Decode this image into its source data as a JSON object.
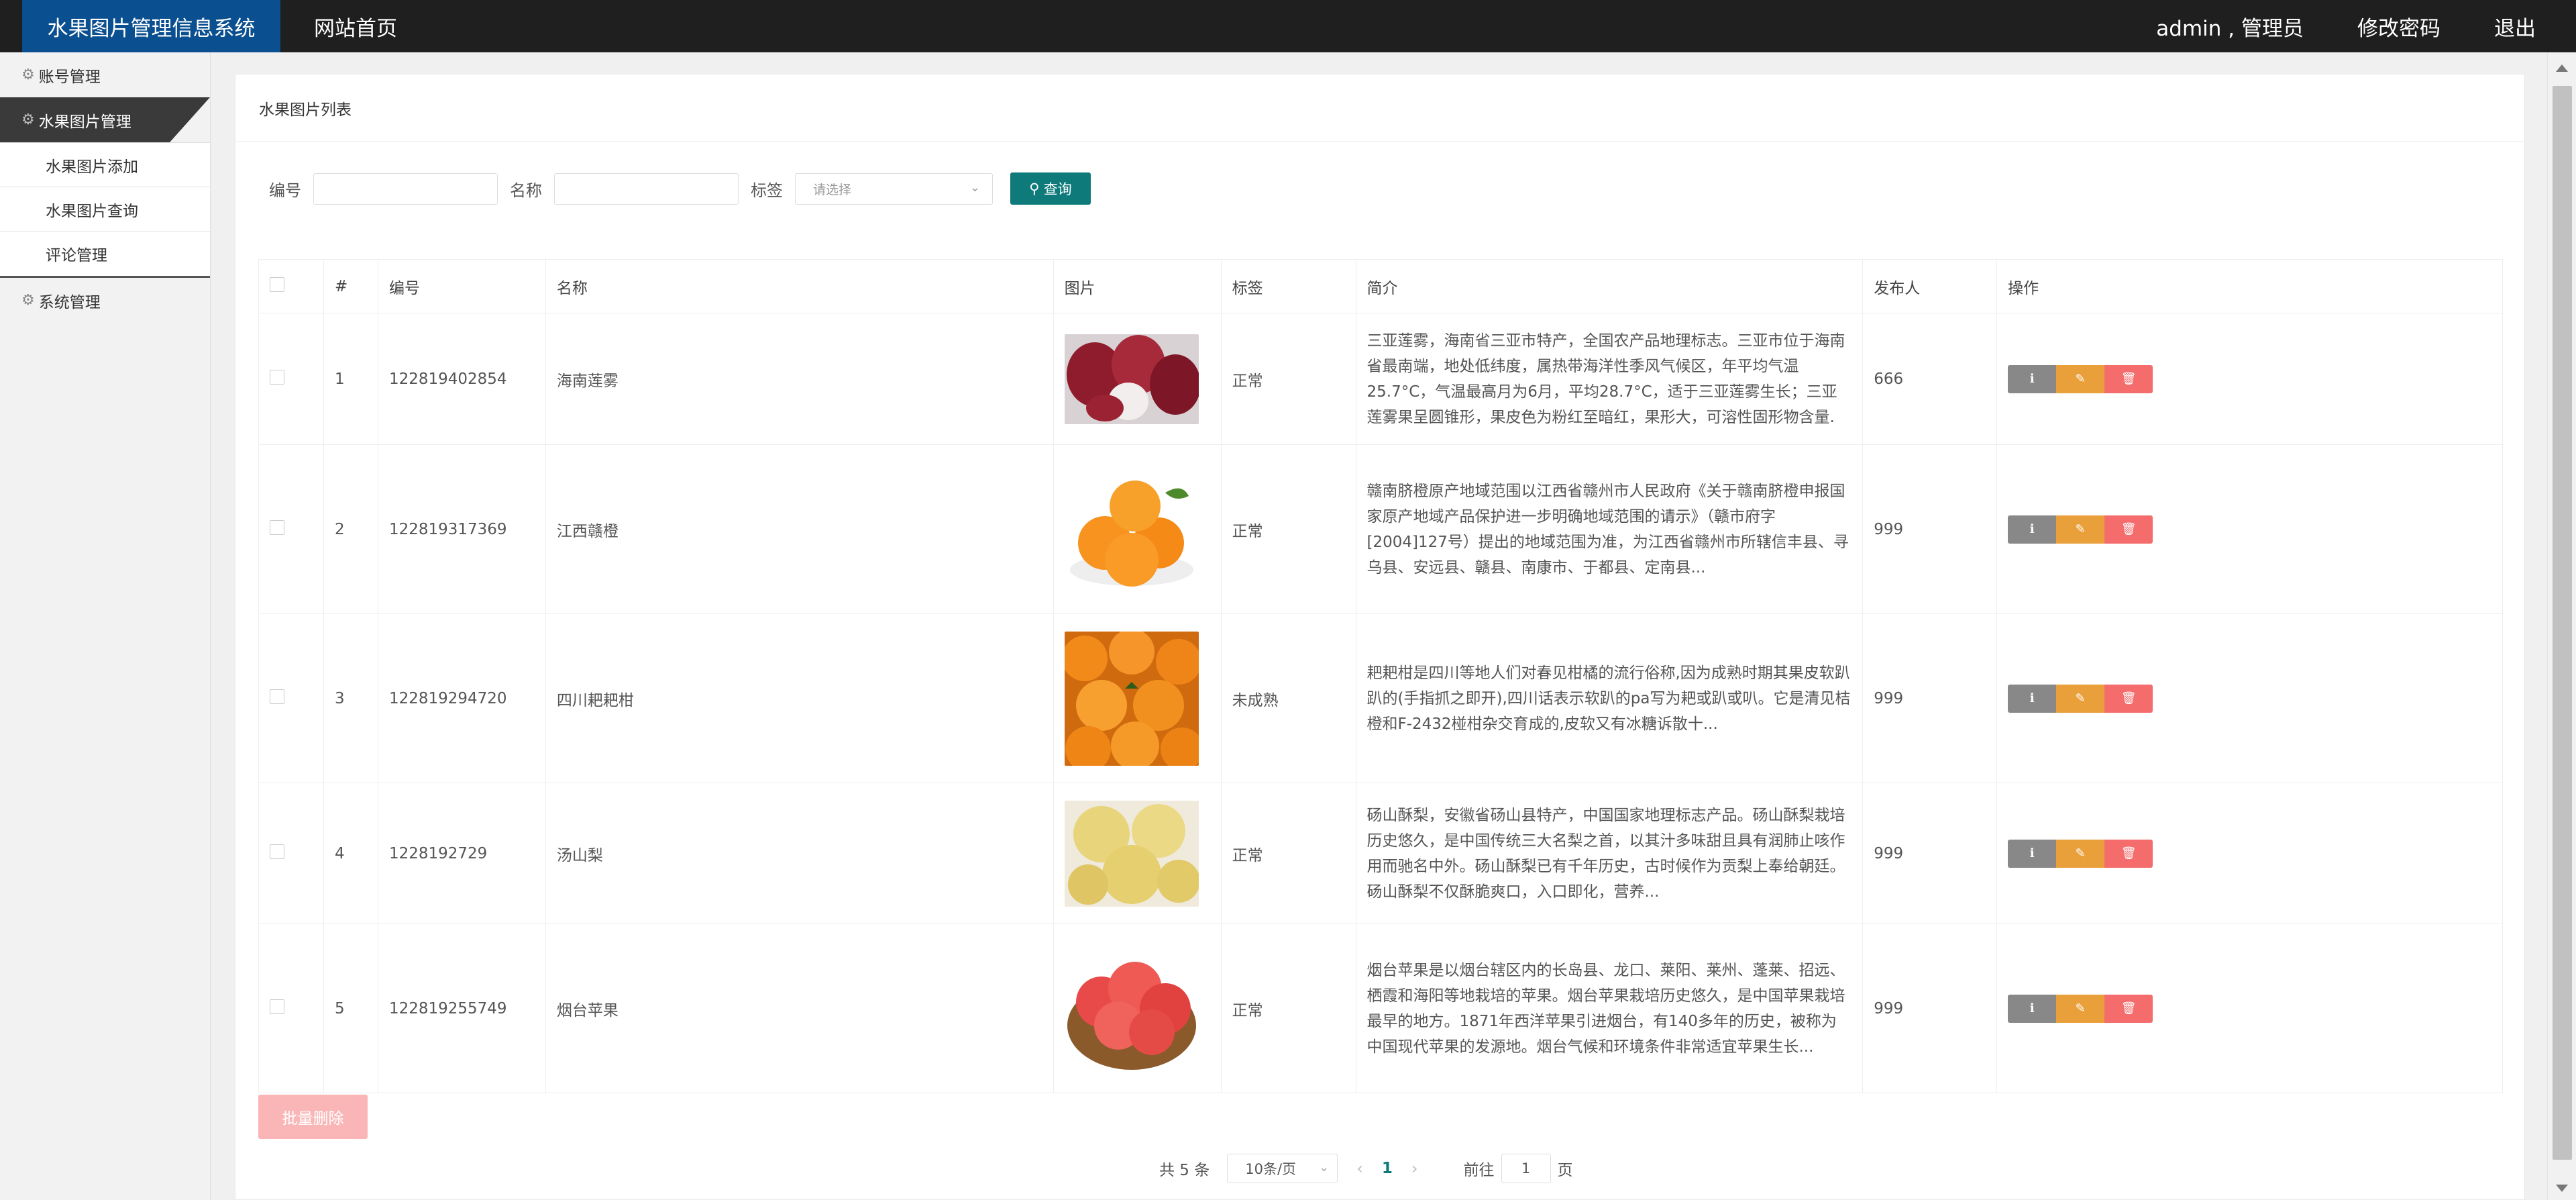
{
  "header": {
    "brand": "水果图片管理信息系统",
    "home_link": "网站首页",
    "user": "admin , 管理员",
    "change_password": "修改密码",
    "logout": "退出"
  },
  "sidebar": {
    "account": "账号管理",
    "fruit_images": "水果图片管理",
    "sub_add": "水果图片添加",
    "sub_query": "水果图片查询",
    "sub_comments": "评论管理",
    "system": "系统管理"
  },
  "panel": {
    "title": "水果图片列表"
  },
  "search": {
    "code_label": "编号",
    "name_label": "名称",
    "tag_label": "标签",
    "tag_placeholder": "请选择",
    "query_button": "查询"
  },
  "table": {
    "headers": [
      "#",
      "编号",
      "名称",
      "图片",
      "标签",
      "简介",
      "发布人",
      "操作"
    ],
    "rows": [
      {
        "index": "1",
        "code": "122819402854",
        "name": "海南莲雾",
        "tag": "正常",
        "desc": "三亚莲雾，海南省三亚市特产，全国农产品地理标志。三亚市位于海南省最南端，地处低纬度，属热带海洋性季风气候区，年平均气温25.7°C，气温最高月为6月，平均28.7°C，适于三亚莲雾生长；三亚莲雾果呈圆锥形，果皮色为粉红至暗红，果形大，可溶性固形物含量.",
        "publisher": "666"
      },
      {
        "index": "2",
        "code": "122819317369",
        "name": "江西赣橙",
        "tag": "正常",
        "desc": "赣南脐橙原产地域范围以江西省赣州市人民政府《关于赣南脐橙申报国家原产地域产品保护进一步明确地域范围的请示》（赣市府字[2004]127号）提出的地域范围为准，为江西省赣州市所辖信丰县、寻乌县、安远县、赣县、南康市、于都县、定南县...",
        "publisher": "999"
      },
      {
        "index": "3",
        "code": "122819294720",
        "name": "四川耙耙柑",
        "tag": "未成熟",
        "desc": "耙耙柑是四川等地人们对春见柑橘的流行俗称,因为成熟时期其果皮软趴趴的(手指抓之即开),四川话表示软趴的pa写为耙或趴或叭。它是清见桔橙和F-2432椪柑杂交育成的,皮软又有冰糖诉散十...",
        "publisher": "999"
      },
      {
        "index": "4",
        "code": "1228192729",
        "name": "汤山梨",
        "tag": "正常",
        "desc": "砀山酥梨，安徽省砀山县特产，中国国家地理标志产品。砀山酥梨栽培历史悠久，是中国传统三大名梨之首，以其汁多味甜且具有润肺止咳作用而驰名中外。砀山酥梨已有千年历史，古时候作为贡梨上奉给朝廷。砀山酥梨不仅酥脆爽口，入口即化，营养...",
        "publisher": "999"
      },
      {
        "index": "5",
        "code": "122819255749",
        "name": "烟台苹果",
        "tag": "正常",
        "desc": "烟台苹果是以烟台辖区内的长岛县、龙口、莱阳、莱州、蓬莱、招远、栖霞和海阳等地栽培的苹果。烟台苹果栽培历史悠久，是中国苹果栽培最早的地方。1871年西洋苹果引进烟台，有140多年的历史，被称为中国现代苹果的发源地。烟台气候和环境条件非常适宜苹果生长...",
        "publisher": "999"
      }
    ]
  },
  "footer": {
    "batch_delete": "批量删除",
    "total": "共 5 条",
    "page_size": "10条/页",
    "current_page": "1",
    "goto_label": "前往",
    "goto_value": "1",
    "page_suffix": "页"
  },
  "colors": {
    "brand_bg": "#0a4f8f",
    "accent": "#0e7a7a",
    "edit": "#e9a03b",
    "delete": "#f56c6c",
    "info": "#888888"
  }
}
